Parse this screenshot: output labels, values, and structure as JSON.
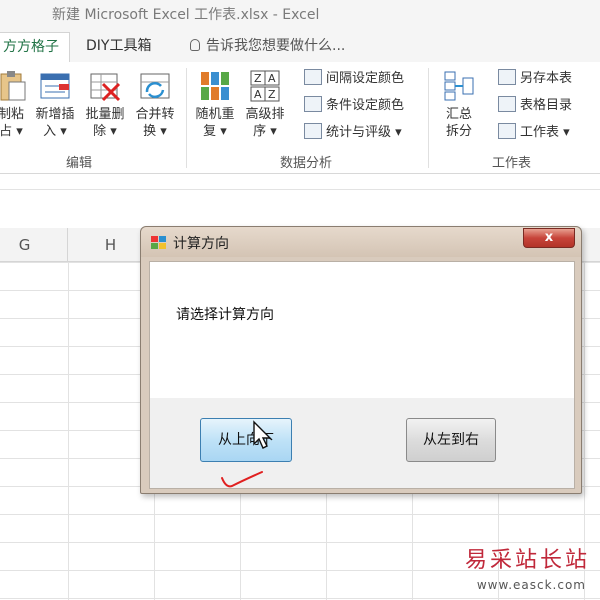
{
  "window": {
    "title": "新建 Microsoft Excel 工作表.xlsx - Excel"
  },
  "tabs": [
    {
      "label": "方方格子",
      "active": true
    },
    {
      "label": "DIY工具箱"
    },
    {
      "label": "告诉我您想要做什么..."
    }
  ],
  "ribbon": {
    "groups": {
      "edit": "编辑",
      "analysis": "数据分析",
      "sheet": "工作表"
    },
    "copy_paste": {
      "line1": "制粘",
      "line2": "占 ▾"
    },
    "new_insert": {
      "line1": "新增插",
      "line2": "入 ▾"
    },
    "batch_delete": {
      "line1": "批量删",
      "line2": "除 ▾"
    },
    "merge_convert": {
      "line1": "合并转",
      "line2": "换 ▾"
    },
    "random_repeat": {
      "line1": "随机重",
      "line2": "复 ▾"
    },
    "advanced_sort": {
      "line1": "高级排",
      "line2": "序 ▾"
    },
    "interval_color": "间隔设定颜色",
    "conditional_color": "条件设定颜色",
    "stats_rating": "统计与评级 ▾",
    "summary_split": {
      "line1": "汇总",
      "line2": "拆分"
    },
    "save_copy": "另存本表",
    "sheet_index": "表格目录",
    "worksheet": "工作表 ▾"
  },
  "columns": [
    "G",
    "H"
  ],
  "dialog": {
    "title": "计算方向",
    "close": "x",
    "message": "请选择计算方向",
    "button_top_down": "从上向下",
    "button_left_right": "从左到右"
  },
  "watermark": {
    "name": "易采站长站",
    "url": "www.easck.com"
  },
  "colors": {
    "excel_green": "#217346",
    "dialog_frame": "#d9cbbd",
    "close_red": "#c7443a",
    "primary_button": "#bfe2f7",
    "annotation_red": "#e02020"
  }
}
